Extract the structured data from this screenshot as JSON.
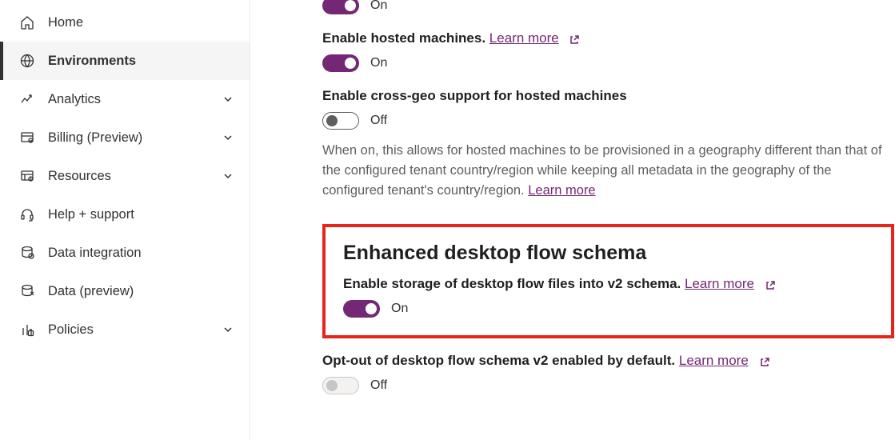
{
  "sidebar": {
    "items": [
      {
        "label": "Home"
      },
      {
        "label": "Environments"
      },
      {
        "label": "Analytics"
      },
      {
        "label": "Billing (Preview)"
      },
      {
        "label": "Resources"
      },
      {
        "label": "Help + support"
      },
      {
        "label": "Data integration"
      },
      {
        "label": "Data (preview)"
      },
      {
        "label": "Policies"
      }
    ]
  },
  "settings": {
    "topToggle": {
      "state": "On"
    },
    "hostedMachines": {
      "label": "Enable hosted machines.",
      "link": "Learn more",
      "state": "On"
    },
    "crossGeo": {
      "label": "Enable cross-geo support for hosted machines",
      "state": "Off",
      "description": "When on, this allows for hosted machines to be provisioned in a geography different than that of the configured tenant country/region while keeping all metadata in the geography of the configured tenant's country/region.",
      "descLink": "Learn more"
    },
    "enhancedSchema": {
      "title": "Enhanced desktop flow schema",
      "label": "Enable storage of desktop flow files into v2 schema.",
      "link": "Learn more",
      "state": "On"
    },
    "optOut": {
      "label": "Opt-out of desktop flow schema v2 enabled by default.",
      "link": "Learn more",
      "state": "Off"
    }
  }
}
